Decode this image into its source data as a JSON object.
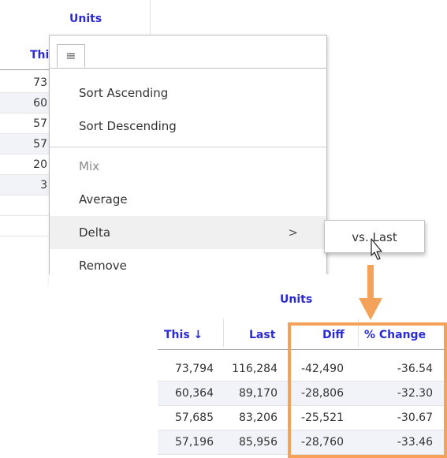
{
  "background_table": {
    "units_label": "Units",
    "this_label": "Thi",
    "partial_values": [
      "73",
      "60",
      "57",
      "57",
      "20",
      "3"
    ]
  },
  "menu": {
    "tab_icon": "hamburger-menu-icon",
    "items": [
      {
        "label": "Sort Ascending"
      },
      {
        "label": "Sort Descending"
      },
      {
        "label": "Mix",
        "disabled": true
      },
      {
        "label": "Average"
      },
      {
        "label": "Delta",
        "has_submenu": true,
        "hover": true
      },
      {
        "label": "Remove"
      }
    ],
    "chevron": ">"
  },
  "submenu": {
    "items": [
      {
        "label": "vs. Last"
      }
    ]
  },
  "result_table": {
    "group_header": "Units",
    "columns": [
      {
        "label": "This ↓"
      },
      {
        "label": "Last"
      },
      {
        "label": "Diff"
      },
      {
        "label": "% Change"
      }
    ],
    "rows": [
      [
        "73,794",
        "116,284",
        "-42,490",
        "-36.54"
      ],
      [
        "60,364",
        "89,170",
        "-28,806",
        "-32.30"
      ],
      [
        "57,685",
        "83,206",
        "-25,521",
        "-30.67"
      ],
      [
        "57,196",
        "85,956",
        "-28,760",
        "-33.46"
      ]
    ]
  },
  "colors": {
    "header_blue": "#2b2bd6",
    "highlight_orange": "#f4a25a",
    "row_shade": "#f2f3f8"
  }
}
